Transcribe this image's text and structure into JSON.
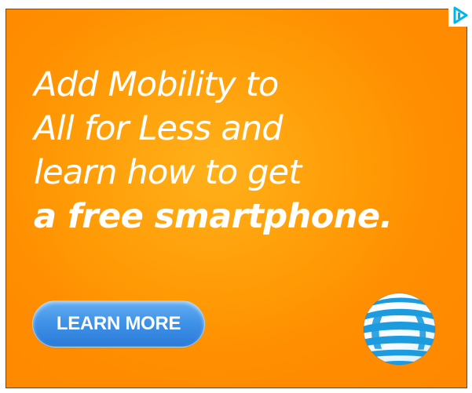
{
  "ad": {
    "headline_lines": [
      "Add Mobility to",
      "All for Less and",
      "learn how to get",
      "a free smartphone."
    ],
    "cta_label": "LEARN MORE",
    "logo_icon": "att-globe-icon",
    "adchoices_icon": "adchoices-icon"
  },
  "colors": {
    "background_orange": "#ff9a05",
    "button_blue": "#3f92e7",
    "logo_blue": "#1d9bdf",
    "text": "#ffffff"
  }
}
